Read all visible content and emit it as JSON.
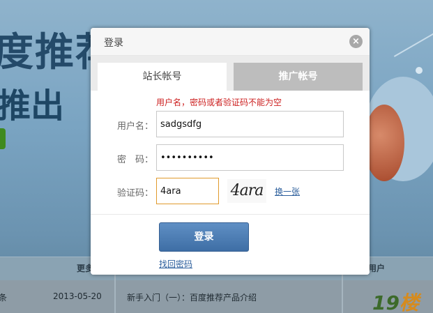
{
  "background": {
    "headline1": "度推荐",
    "headline2": "推出",
    "more_label": "更多",
    "users_label": "用户",
    "news_date": "2013-05-20",
    "news_title": "新手入门（一）：百度推荐产品介绍",
    "cut_text": "条",
    "brand_number": "19",
    "brand_char": "楼"
  },
  "modal": {
    "title": "登录",
    "close_symbol": "×",
    "tabs": [
      {
        "label": "站长帐号",
        "active": true
      },
      {
        "label": "推广帐号",
        "active": false
      }
    ],
    "error_message": "用户名，密码或者验证码不能为空",
    "username": {
      "label": "用户名：",
      "value": "sadgsdfg"
    },
    "password": {
      "label": "密　码：",
      "value": "••••••••••"
    },
    "captcha": {
      "label": "验证码：",
      "value": "4ara",
      "image_text": "4ara",
      "refresh_label": "换一张"
    },
    "login_button": "登录",
    "forgot_link": "找回密码"
  },
  "colors": {
    "error": "#cc1f1f",
    "primary_button": "#4a7bb2",
    "link": "#2d5f9c",
    "captcha_focus_border": "#e09a2c"
  }
}
